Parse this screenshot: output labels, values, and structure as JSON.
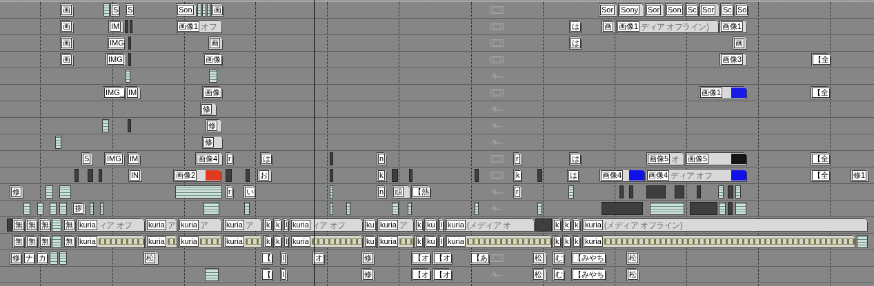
{
  "tracks": [
    {
      "kind": "video",
      "clips": [
        {
          "kind": "event",
          "label": "画"
        },
        {
          "kind": "strip"
        },
        {
          "kind": "event",
          "label": "S"
        },
        {
          "kind": "event",
          "label": "S"
        },
        {
          "kind": "event",
          "label": "Son"
        },
        {
          "kind": "strip"
        },
        {
          "kind": "strip"
        },
        {
          "kind": "strip"
        },
        {
          "kind": "event",
          "label": "画"
        },
        {
          "kind": "event",
          "label": "Sor"
        },
        {
          "kind": "event",
          "label": "Sony"
        },
        {
          "kind": "event",
          "label": "Sor"
        },
        {
          "kind": "event",
          "label": "Son"
        },
        {
          "kind": "event",
          "label": "Sc"
        },
        {
          "kind": "event",
          "label": "Sor"
        },
        {
          "kind": "event",
          "label": "Sc"
        },
        {
          "kind": "event",
          "label": "So"
        }
      ]
    },
    {
      "kind": "video",
      "clips": [
        {
          "kind": "event",
          "label": "画"
        },
        {
          "kind": "event",
          "label": "IM"
        },
        {
          "kind": "bar"
        },
        {
          "kind": "bar"
        },
        {
          "kind": "event",
          "label": "画像1",
          "note": "オフ"
        },
        {
          "kind": "event",
          "label": "は"
        },
        {
          "kind": "event",
          "label": "画"
        },
        {
          "kind": "event",
          "label": "画像1",
          "note": "ディア オフライン)"
        },
        {
          "kind": "event",
          "label": "画像1"
        }
      ]
    },
    {
      "kind": "video",
      "clips": [
        {
          "kind": "event",
          "label": "画"
        },
        {
          "kind": "event",
          "label": "IMG"
        },
        {
          "kind": "bar"
        },
        {
          "kind": "event",
          "label": "画"
        },
        {
          "kind": "event",
          "label": "は"
        },
        {
          "kind": "event",
          "label": "画"
        }
      ]
    },
    {
      "kind": "video",
      "clips": [
        {
          "kind": "event",
          "label": "画"
        },
        {
          "kind": "event",
          "label": "IMG"
        },
        {
          "kind": "bar"
        },
        {
          "kind": "event",
          "label": "画像"
        },
        {
          "kind": "event",
          "label": "画像3"
        },
        {
          "kind": "event",
          "label": "【全"
        }
      ]
    },
    {
      "kind": "audio",
      "clips": [
        {
          "kind": "strip"
        },
        {
          "kind": "strip"
        }
      ]
    },
    {
      "kind": "video",
      "clips": [
        {
          "kind": "event",
          "label": "IMG_"
        },
        {
          "kind": "event",
          "label": "IM"
        },
        {
          "kind": "event",
          "label": "画像"
        },
        {
          "kind": "event",
          "label": "画像1",
          "color": "#1a1ae6"
        },
        {
          "kind": "event",
          "label": "【全"
        }
      ]
    },
    {
      "kind": "audio",
      "clips": [
        {
          "kind": "event",
          "label": "修"
        }
      ]
    },
    {
      "kind": "audio",
      "clips": [
        {
          "kind": "strip"
        },
        {
          "kind": "bar"
        },
        {
          "kind": "event",
          "label": "修"
        }
      ]
    },
    {
      "kind": "audio",
      "clips": [
        {
          "kind": "strip"
        },
        {
          "kind": "event",
          "label": "修"
        }
      ]
    },
    {
      "kind": "video",
      "clips": [
        {
          "kind": "event",
          "label": "S"
        },
        {
          "kind": "event",
          "label": "IMG"
        },
        {
          "kind": "event",
          "label": "IM"
        },
        {
          "kind": "event",
          "label": "画像4"
        },
        {
          "kind": "event",
          "label": "r"
        },
        {
          "kind": "event",
          "label": "は"
        },
        {
          "kind": "bar"
        },
        {
          "kind": "event",
          "label": "n"
        },
        {
          "kind": "event",
          "label": "r"
        },
        {
          "kind": "event",
          "label": "は"
        },
        {
          "kind": "event",
          "label": "画像5",
          "note": "オ"
        },
        {
          "kind": "event",
          "label": "画像5",
          "color": "#151515"
        },
        {
          "kind": "event",
          "label": "【全"
        }
      ]
    },
    {
      "kind": "video",
      "clips": [
        {
          "kind": "bar"
        },
        {
          "kind": "bar"
        },
        {
          "kind": "bar"
        },
        {
          "kind": "event",
          "label": "IN"
        },
        {
          "kind": "event",
          "label": "画像2",
          "color": "#e03a20"
        },
        {
          "kind": "bar"
        },
        {
          "kind": "bar"
        },
        {
          "kind": "event",
          "label": "お"
        },
        {
          "kind": "bar"
        },
        {
          "kind": "event",
          "label": "k"
        },
        {
          "kind": "bar"
        },
        {
          "kind": "bar"
        },
        {
          "kind": "bar"
        },
        {
          "kind": "event",
          "label": "k"
        },
        {
          "kind": "bar"
        },
        {
          "kind": "event",
          "label": "は"
        },
        {
          "kind": "event",
          "label": "画像4",
          "color": "#1010e8"
        },
        {
          "kind": "event",
          "label": "画像4",
          "note": "ディア オフ",
          "color": "#1010e8"
        },
        {
          "kind": "event",
          "label": "【全"
        },
        {
          "kind": "event",
          "label": "修1"
        }
      ]
    },
    {
      "kind": "audio",
      "clips": [
        {
          "kind": "event",
          "label": "修"
        },
        {
          "kind": "strip"
        },
        {
          "kind": "strip"
        },
        {
          "kind": "strip"
        },
        {
          "kind": "event",
          "label": "r"
        },
        {
          "kind": "event",
          "label": "い"
        },
        {
          "kind": "strip"
        },
        {
          "kind": "event",
          "label": "n"
        },
        {
          "kind": "event",
          "label": "頑"
        },
        {
          "kind": "event",
          "label": "【熱"
        },
        {
          "kind": "event",
          "label": "r"
        },
        {
          "kind": "strip"
        },
        {
          "kind": "bar"
        },
        {
          "kind": "bar"
        },
        {
          "kind": "bar"
        },
        {
          "kind": "bar"
        },
        {
          "kind": "bar"
        },
        {
          "kind": "strip"
        },
        {
          "kind": "bar"
        },
        {
          "kind": "strip"
        }
      ]
    },
    {
      "kind": "audio",
      "clips": [
        {
          "kind": "strip"
        },
        {
          "kind": "strip"
        },
        {
          "kind": "strip"
        },
        {
          "kind": "strip"
        },
        {
          "kind": "event",
          "label": "拶"
        },
        {
          "kind": "strip"
        },
        {
          "kind": "strip"
        },
        {
          "kind": "strip"
        },
        {
          "kind": "strip"
        },
        {
          "kind": "strip"
        },
        {
          "kind": "strip"
        },
        {
          "kind": "strip"
        },
        {
          "kind": "strip"
        },
        {
          "kind": "strip"
        },
        {
          "kind": "strip"
        },
        {
          "kind": "bar"
        },
        {
          "kind": "strip"
        },
        {
          "kind": "bar"
        },
        {
          "kind": "strip"
        },
        {
          "kind": "bar"
        },
        {
          "kind": "strip"
        }
      ]
    },
    {
      "kind": "video-filled",
      "clips": [
        {
          "kind": "bar"
        },
        {
          "kind": "event",
          "label": "無"
        },
        {
          "kind": "event",
          "label": "無"
        },
        {
          "kind": "event",
          "label": "無"
        },
        {
          "kind": "strip"
        },
        {
          "kind": "event",
          "label": "無"
        },
        {
          "kind": "event",
          "label": "kuria",
          "note": "ィア オフ"
        },
        {
          "kind": "event",
          "label": "kuria",
          "note": "ア"
        },
        {
          "kind": "event",
          "label": "kuria",
          "note": "ア"
        },
        {
          "kind": "event",
          "label": "kuria",
          "note": "ア"
        },
        {
          "kind": "event",
          "label": "k"
        },
        {
          "kind": "event",
          "label": "k"
        },
        {
          "kind": "event",
          "label": "l"
        },
        {
          "kind": "event",
          "label": "kuria",
          "note": "ィア オフ"
        },
        {
          "kind": "event",
          "label": "ku"
        },
        {
          "kind": "event",
          "label": "kuria",
          "note": "ア"
        },
        {
          "kind": "event",
          "label": "k"
        },
        {
          "kind": "event",
          "label": "ku"
        },
        {
          "kind": "event",
          "label": "l"
        },
        {
          "kind": "event",
          "label": "kuria",
          "note": "(メディア オ"
        },
        {
          "kind": "bar"
        },
        {
          "kind": "event",
          "label": "k"
        },
        {
          "kind": "event",
          "label": "k"
        },
        {
          "kind": "event",
          "label": "k"
        },
        {
          "kind": "event",
          "label": "kuria",
          "note": "(メディア オフライン)"
        }
      ]
    },
    {
      "kind": "audio-filled",
      "clips": [
        {
          "kind": "event",
          "label": "無"
        },
        {
          "kind": "event",
          "label": "無"
        },
        {
          "kind": "event",
          "label": "無"
        },
        {
          "kind": "strip"
        },
        {
          "kind": "event",
          "label": "無"
        },
        {
          "kind": "event",
          "label": "kuria"
        },
        {
          "kind": "event",
          "label": "kuria"
        },
        {
          "kind": "event",
          "label": "kuria"
        },
        {
          "kind": "event",
          "label": "kuria"
        },
        {
          "kind": "event",
          "label": "k"
        },
        {
          "kind": "event",
          "label": "k"
        },
        {
          "kind": "event",
          "label": "l"
        },
        {
          "kind": "event",
          "label": "kuria"
        },
        {
          "kind": "event",
          "label": "ku"
        },
        {
          "kind": "event",
          "label": "kuria"
        },
        {
          "kind": "event",
          "label": "k"
        },
        {
          "kind": "event",
          "label": "ku"
        },
        {
          "kind": "event",
          "label": "l"
        },
        {
          "kind": "event",
          "label": "kuria"
        },
        {
          "kind": "event",
          "label": "k"
        },
        {
          "kind": "event",
          "label": "k"
        },
        {
          "kind": "event",
          "label": "k"
        },
        {
          "kind": "event",
          "label": "kuria"
        },
        {
          "kind": "strip"
        }
      ]
    },
    {
      "kind": "video",
      "clips": [
        {
          "kind": "event",
          "label": "修"
        },
        {
          "kind": "event",
          "label": "ナ"
        },
        {
          "kind": "event",
          "label": "カ"
        },
        {
          "kind": "strip"
        },
        {
          "kind": "strip"
        },
        {
          "kind": "event",
          "label": "松"
        },
        {
          "kind": "event",
          "label": "【"
        },
        {
          "kind": "event",
          "label": "l"
        },
        {
          "kind": "event",
          "label": "オ"
        },
        {
          "kind": "event",
          "label": "修"
        },
        {
          "kind": "event",
          "label": "【オ"
        },
        {
          "kind": "event",
          "label": "【オ"
        },
        {
          "kind": "event",
          "label": "【あ"
        },
        {
          "kind": "event",
          "label": "松"
        },
        {
          "kind": "event",
          "label": "む"
        },
        {
          "kind": "event",
          "label": "【みやち"
        },
        {
          "kind": "event",
          "label": "松"
        }
      ]
    },
    {
      "kind": "audio",
      "clips": [
        {
          "kind": "strip"
        },
        {
          "kind": "event",
          "label": "【"
        },
        {
          "kind": "event",
          "label": "l"
        },
        {
          "kind": "event",
          "label": "修"
        },
        {
          "kind": "event",
          "label": "【オ"
        },
        {
          "kind": "event",
          "label": "【オ"
        },
        {
          "kind": "event",
          "label": "松"
        },
        {
          "kind": "event",
          "label": "む"
        },
        {
          "kind": "event",
          "label": "【みやち"
        },
        {
          "kind": "event",
          "label": "松"
        }
      ]
    }
  ]
}
